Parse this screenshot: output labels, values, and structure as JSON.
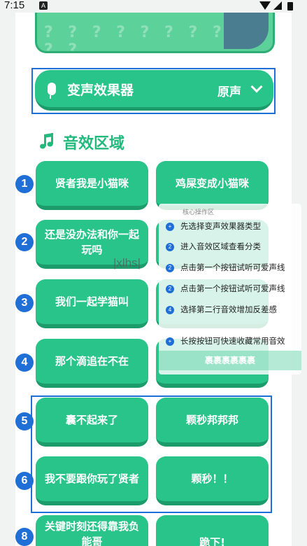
{
  "status_bar": {
    "time": "7:15",
    "app_icon": "A"
  },
  "banner": {
    "decor": "? ? ? ? ? ? ? ? ? ? ?"
  },
  "voice_changer": {
    "title": "变声效果器",
    "value": "原声"
  },
  "section": {
    "title": "音效区域"
  },
  "badges": [
    "1",
    "2",
    "3",
    "4",
    "5",
    "6",
    "8"
  ],
  "sounds": {
    "row1": [
      "贤者我是小猫咪",
      "鸡屎变成小猫咪"
    ],
    "row2": [
      "还是没办法和你一起玩吗"
    ],
    "row3": [
      "我们一起学猫叫"
    ],
    "row4": [
      "那个滴追在不在"
    ],
    "row5": [
      "囊不起来了",
      "颗秒邦邦邦"
    ],
    "row6": [
      "我不要跟你玩了贤者",
      "颗秒！！"
    ],
    "row8": [
      "关键时刻还得靠我负能哥",
      "跪下!"
    ]
  },
  "overlay": {
    "title": "核心操作区",
    "items": [
      {
        "num": "+",
        "text": "先选择变声效果器类型"
      },
      {
        "num": "2",
        "text": "进入音效区域查看分类"
      },
      {
        "num": "2",
        "text": "点击第一个按钮试听可爱声线"
      },
      {
        "num": "2",
        "text": "点击第一个按钮试听可爱声线"
      },
      {
        "num": "4",
        "text": "选择第二行音效增加反差感"
      },
      {
        "num": "+",
        "text": "长按按钮可快速收藏常用音效"
      }
    ],
    "strip": "裹裹裹裹裹裹"
  },
  "watermark": "|xlhs|",
  "colors": {
    "primary_green": "#29c48a",
    "dark_green": "#1d9c6b",
    "accent_blue": "#1f6fd6",
    "title_green": "#22b97d"
  }
}
